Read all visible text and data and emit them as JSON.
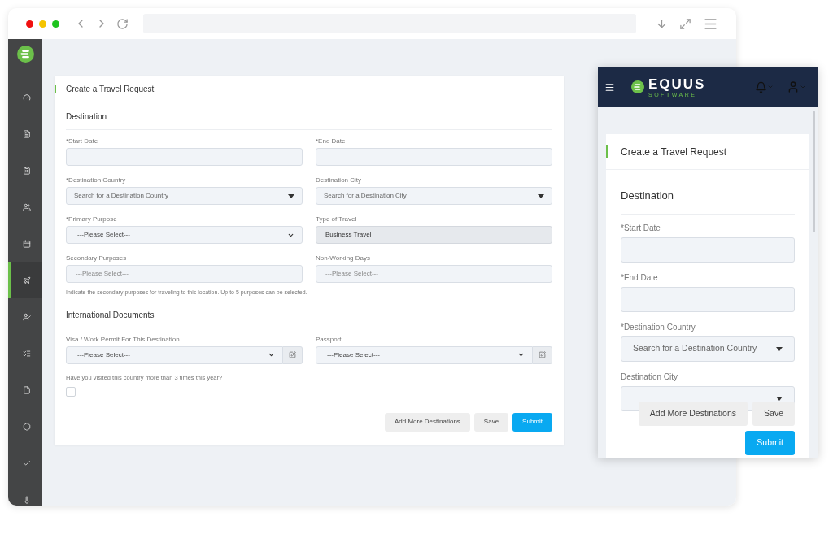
{
  "browser": {
    "sidebar": {
      "items": [
        {
          "selected": false
        },
        {
          "selected": false
        },
        {
          "selected": false
        },
        {
          "selected": false
        },
        {
          "selected": false
        },
        {
          "selected": true
        },
        {
          "selected": false
        },
        {
          "selected": false
        },
        {
          "selected": false
        },
        {
          "selected": false
        },
        {
          "selected": false
        },
        {
          "selected": false
        }
      ]
    },
    "form": {
      "title": "Create a Travel Request",
      "sections": [
        {
          "heading": "Destination",
          "fields": [
            {
              "label": "*Start Date",
              "kind": "text"
            },
            {
              "label": "*End Date",
              "kind": "text"
            },
            {
              "label": "*Destination Country",
              "kind": "search",
              "placeholder": "Search for a Destination Country"
            },
            {
              "label": "Destination City",
              "kind": "search",
              "placeholder": "Search for a Destination City"
            },
            {
              "label": "*Primary Purpose",
              "kind": "select",
              "value": "---Please Select---"
            },
            {
              "label": "Type of Travel",
              "kind": "readonly",
              "value": "Business Travel"
            },
            {
              "label": "Secondary Purposes",
              "kind": "multi",
              "placeholder": "---Please Select---"
            },
            {
              "label": "Non-Working Days",
              "kind": "multi",
              "placeholder": "---Please Select---"
            }
          ],
          "note": "Indicate the secondary purposes for traveling to this location. Up to 5 purposes can be selected."
        },
        {
          "heading": "International Documents",
          "fields": [
            {
              "label": "Visa / Work Permit For This Destination",
              "kind": "select_edit",
              "value": "---Please Select---"
            },
            {
              "label": "Passport",
              "kind": "select_edit",
              "value": "---Please Select---"
            }
          ],
          "question": "Have you visited this country more than 3 times this year?",
          "checked": false
        }
      ],
      "buttons": [
        {
          "label": "Add More Destinations",
          "kind": "secondary"
        },
        {
          "label": "Save",
          "kind": "secondary"
        },
        {
          "label": "Submit",
          "kind": "primary"
        }
      ]
    }
  },
  "mobile": {
    "header": {
      "brand": "EQUUS",
      "tagline": "SOFTWARE"
    },
    "form": {
      "title": "Create a Travel Request",
      "heading": "Destination",
      "fields": [
        {
          "label": "*Start Date",
          "kind": "text"
        },
        {
          "label": "*End Date",
          "kind": "text"
        },
        {
          "label": "*Destination Country",
          "kind": "search",
          "placeholder": "Search for a Destination Country"
        },
        {
          "label": "Destination City",
          "kind": "search"
        }
      ],
      "buttons": [
        {
          "label": "Add More Destinations",
          "kind": "secondary"
        },
        {
          "label": "Save",
          "kind": "secondary"
        },
        {
          "label": "Submit",
          "kind": "primary"
        }
      ]
    }
  }
}
